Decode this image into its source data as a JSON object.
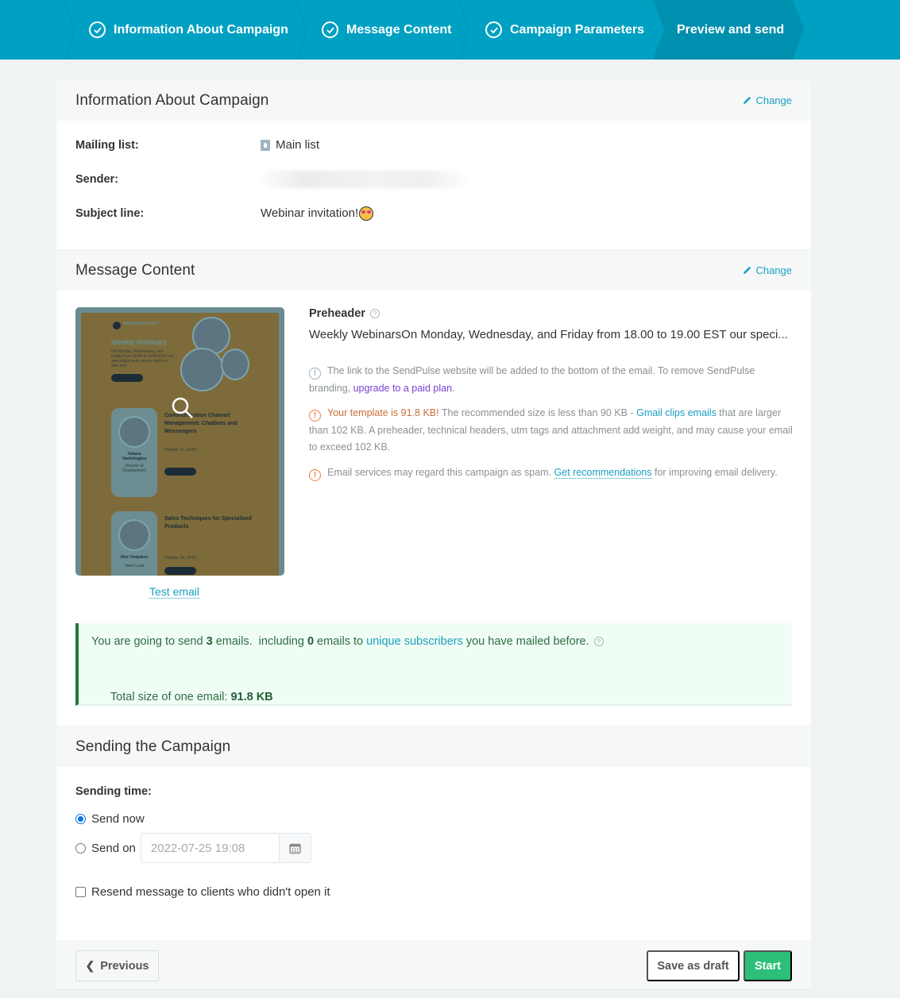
{
  "stepper": {
    "steps": [
      {
        "label": "Information About Campaign",
        "completed": true
      },
      {
        "label": "Message Content",
        "completed": true
      },
      {
        "label": "Campaign Parameters",
        "completed": true
      },
      {
        "label": "Preview and send",
        "completed": false,
        "active": true
      }
    ]
  },
  "info_section": {
    "title": "Information About Campaign",
    "change_label": "Change",
    "mailing_list_label": "Mailing list:",
    "mailing_list_value": "Main list",
    "sender_label": "Sender:",
    "sender_value_redacted": true,
    "subject_label": "Subject line:",
    "subject_value": "Webinar invitation!",
    "subject_emoji": "star-struck-emoji"
  },
  "message_section": {
    "title": "Message Content",
    "change_label": "Change",
    "preview": {
      "brand": "WEBINAR STREET",
      "heading": "Weekly Webinars",
      "events": [
        {
          "title": "Communication Channel Management: Chatbots and Messengers",
          "speaker": "Tatiana Vashchagina",
          "role": "Director of Development",
          "date": "October 27, 18:00",
          "button": "REGISTER"
        },
        {
          "title": "Sales Techniques for Specialized Products",
          "speaker": "Alex Yevpakov",
          "role": "Team Lead",
          "date": "October 29, 18:00",
          "button": "REGISTER"
        }
      ]
    },
    "test_email_label": "Test email",
    "preheader_label": "Preheader",
    "preheader_value": "Weekly WebinarsOn Monday, Wednesday, and Friday from 18.00 to 19.00 EST our speci...",
    "notes": {
      "branding_text": "The link to the SendPulse website will be added to the bottom of the email. To remove SendPulse branding, ",
      "branding_link": "upgrade to a paid plan",
      "branding_end": ".",
      "size_warning": "Your template is 91.8 KB!",
      "size_text_1": " The recommended size is less than 90 KB - ",
      "size_link": "Gmail clips emails",
      "size_text_2": " that are larger than 102 KB. A preheader, technical headers, utm tags and attachment add weight, and may cause your email to exceed 102 KB.",
      "spam_text": "Email services may regard this campaign as spam. ",
      "spam_link": "Get recommendations",
      "spam_end": " for improving email delivery."
    },
    "summary": {
      "part1": "You are going to send ",
      "emails_count": "3",
      "part2": " emails.  including ",
      "unique_count": "0",
      "part3": " emails to ",
      "unique_link": "unique subscribers",
      "part4": " you have mailed before.",
      "size_label": "Total size of one email: ",
      "size_value": "91.8 KB"
    }
  },
  "sending_section": {
    "title": "Sending the Campaign",
    "time_label": "Sending time:",
    "send_now_label": "Send now",
    "send_now_selected": true,
    "send_on_label": "Send on",
    "send_on_value": "2022-07-25 19:08",
    "resend_label": "Resend message to clients who didn't open it",
    "resend_checked": false
  },
  "footer": {
    "previous_label": "Previous",
    "draft_label": "Save as draft",
    "start_label": "Start"
  },
  "colors": {
    "header": "#00a0c2",
    "active_step": "#0090af",
    "link": "#1a9fc0",
    "start": "#2dbf78",
    "warning": "#ec7c43",
    "success_border": "#1f7a3e"
  }
}
